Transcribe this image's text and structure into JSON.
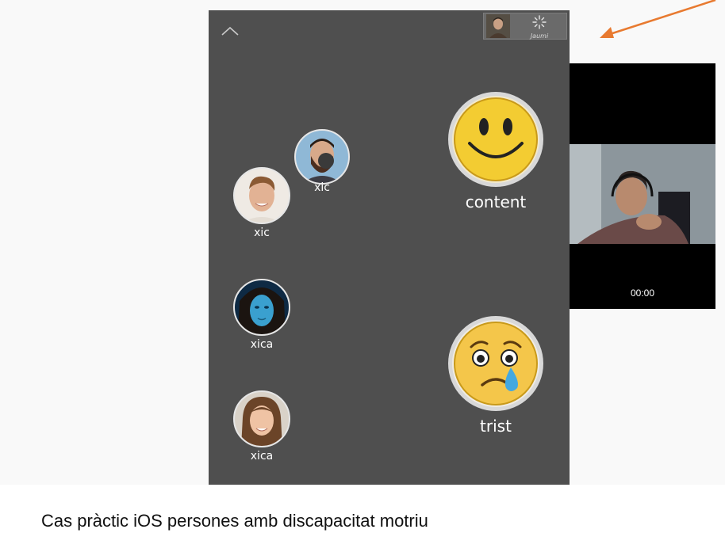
{
  "app": {
    "background": "#4f4f4f",
    "collapse_icon": "chevron-up-icon",
    "thumbnails": {
      "spinner_label": "Jaumi"
    },
    "people": [
      {
        "label": "xic",
        "photo": "bearded-man-photo"
      },
      {
        "label": "xic",
        "photo": "young-man-photo"
      },
      {
        "label": "xica",
        "photo": "woman-blue-tint-photo"
      },
      {
        "label": "xica",
        "photo": "girl-photo"
      }
    ],
    "emotions": [
      {
        "label": "content",
        "icon": "smiling-face-icon"
      },
      {
        "label": "trist",
        "icon": "crying-face-icon"
      }
    ]
  },
  "video": {
    "timer": "00:00"
  },
  "annotation": {
    "arrow_color": "#e87a30"
  },
  "caption": "Cas pràctic iOS persones amb discapacitat motriu"
}
